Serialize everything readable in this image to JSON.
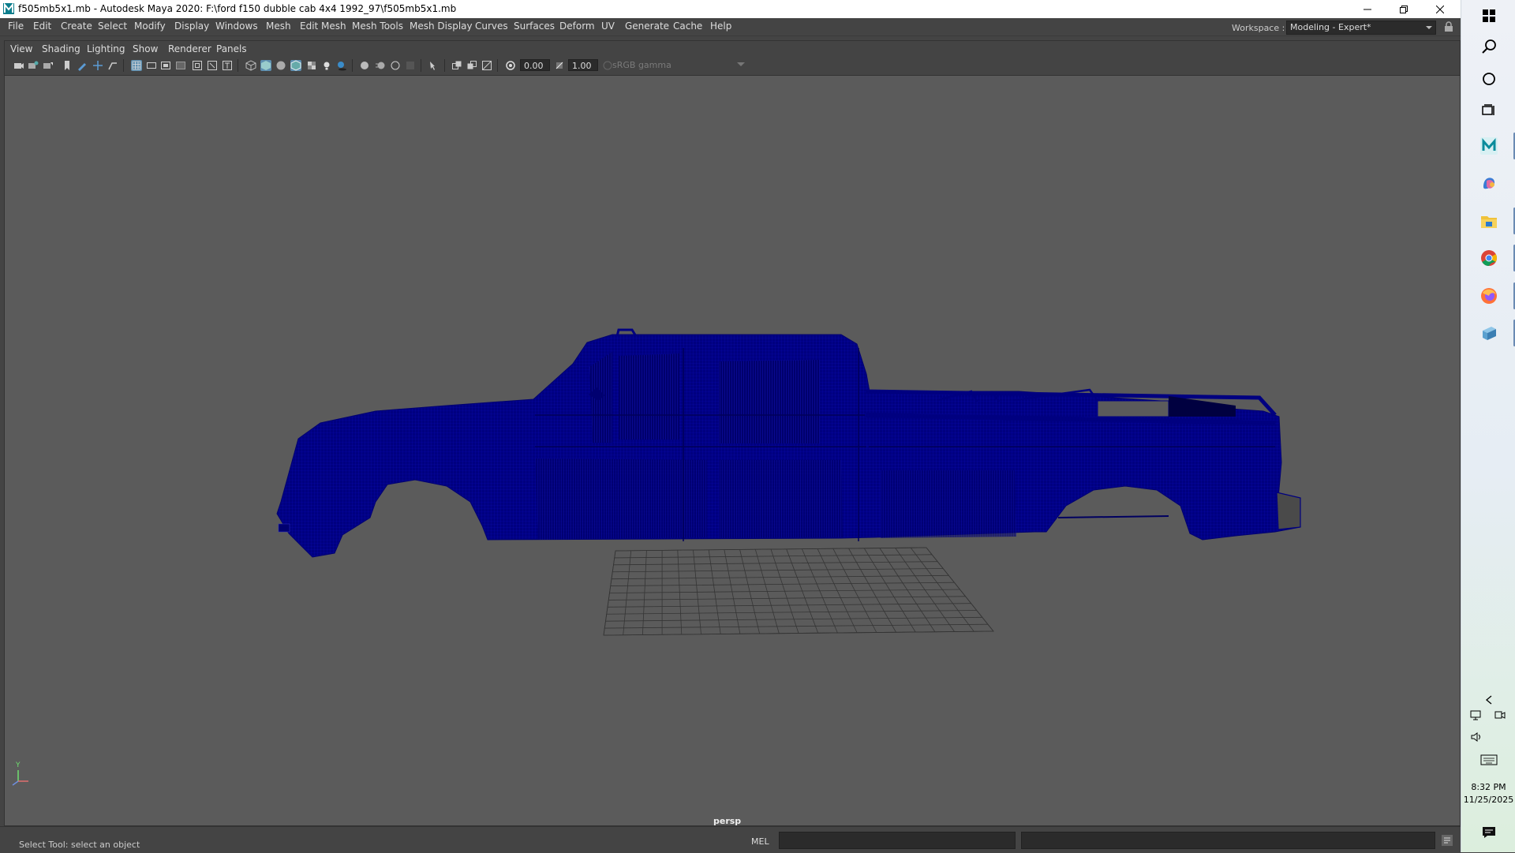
{
  "window": {
    "title": "f505mb5x1.mb - Autodesk Maya 2020: F:\\ford f150 dubble cab 4x4 1992_97\\f505mb5x1.mb",
    "icons": [
      "maya-app-icon",
      "minimize-icon",
      "restore-icon",
      "close-icon"
    ]
  },
  "menubar": {
    "items": [
      "File",
      "Edit",
      "Create",
      "Select",
      "Modify",
      "Display",
      "Windows",
      "Mesh",
      "Edit Mesh",
      "Mesh Tools",
      "Mesh Display",
      "Curves",
      "Surfaces",
      "Deform",
      "UV",
      "Generate",
      "Cache",
      "Help"
    ],
    "workspace_label": "Workspace :",
    "workspace_value": "Modeling - Expert*"
  },
  "panel": {
    "menu": [
      "View",
      "Shading",
      "Lighting",
      "Show",
      "Renderer",
      "Panels"
    ],
    "exposure": "0.00",
    "gamma": "1.00",
    "color_space": "sRGB gamma",
    "camera_label": "persp"
  },
  "statusbar": {
    "help_text": "Select Tool: select an object",
    "mel_label": "MEL"
  },
  "taskbar": {
    "time": "8:32 PM",
    "date": "11/25/2025",
    "icons": [
      "windows-start-icon",
      "search-icon",
      "cortana-icon",
      "task-view-icon",
      "maya-icon",
      "copilot-icon",
      "file-explorer-icon",
      "chrome-icon",
      "firefox-icon",
      "app-icon",
      "chevron-left-icon",
      "network-icon",
      "meet-icon",
      "volume-icon",
      "keyboard-icon",
      "notification-icon"
    ]
  },
  "colors": {
    "viewport_bg": "#5b5b5b",
    "mesh_wire": "#000080",
    "grid": "#2f2f2f",
    "ui_bg": "#444444"
  }
}
